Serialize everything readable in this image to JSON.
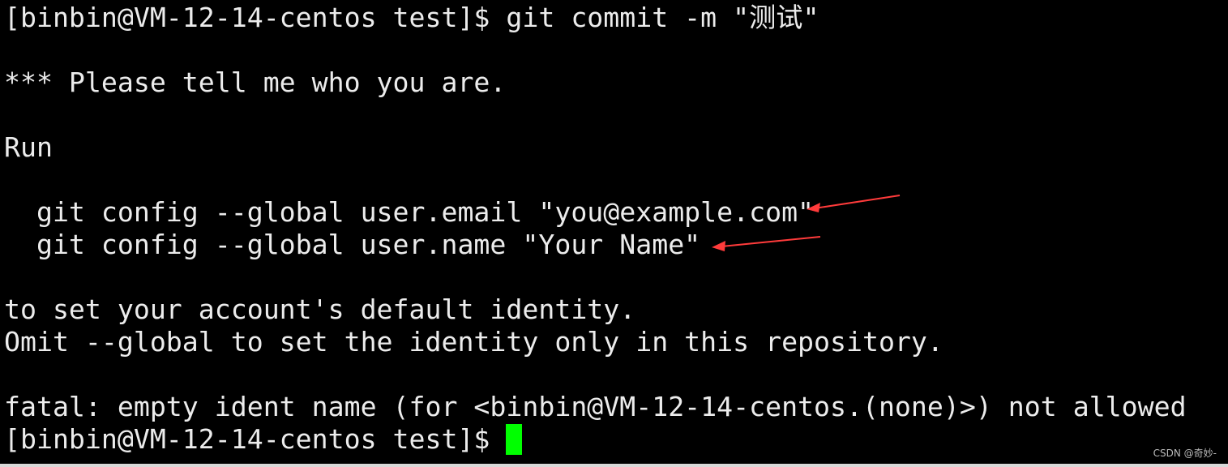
{
  "terminal": {
    "prompt": "[binbin@VM-12-14-centos test]$ ",
    "lines": [
      "[binbin@VM-12-14-centos test]$ git commit -m \"测试\"",
      "",
      "*** Please tell me who you are.",
      "",
      "Run",
      "",
      "  git config --global user.email \"you@example.com\"",
      "  git config --global user.name \"Your Name\"",
      "",
      "to set your account's default identity.",
      "Omit --global to set the identity only in this repository.",
      "",
      "fatal: empty ident name (for <binbin@VM-12-14-centos.(none)>) not allowed"
    ],
    "cursor_color": "#00ff00",
    "text_color": "#ececec",
    "background": "#000000"
  },
  "annotations": {
    "arrow_color": "#ff3b3b"
  },
  "watermark": "CSDN @奇妙-"
}
